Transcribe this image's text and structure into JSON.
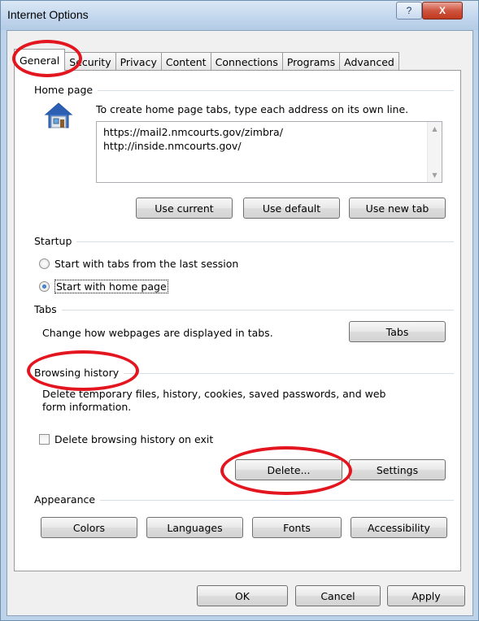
{
  "window": {
    "title": "Internet Options",
    "help_label": "?",
    "close_label": "X"
  },
  "tabs": [
    {
      "label": "General",
      "active": true
    },
    {
      "label": "Security"
    },
    {
      "label": "Privacy"
    },
    {
      "label": "Content"
    },
    {
      "label": "Connections"
    },
    {
      "label": "Programs"
    },
    {
      "label": "Advanced"
    }
  ],
  "home_page": {
    "heading": "Home page",
    "description": "To create home page tabs, type each address on its own line.",
    "urls_line1": "https://mail2.nmcourts.gov/zimbra/",
    "urls_line2": "http://inside.nmcourts.gov/",
    "use_current": "Use current",
    "use_default": "Use default",
    "use_new_tab": "Use new tab"
  },
  "startup": {
    "heading": "Startup",
    "option1": "Start with tabs from the last session",
    "option2": "Start with home page",
    "selected": "Start with home page"
  },
  "tabs_group": {
    "heading": "Tabs",
    "description": "Change how webpages are displayed in tabs.",
    "button": "Tabs"
  },
  "browsing_history": {
    "heading": "Browsing history",
    "description_line1": "Delete temporary files, history, cookies, saved passwords, and web",
    "description_line2": "form information.",
    "checkbox_label": "Delete browsing history on exit",
    "delete_button": "Delete...",
    "settings_button": "Settings"
  },
  "appearance": {
    "heading": "Appearance",
    "colors": "Colors",
    "languages": "Languages",
    "fonts": "Fonts",
    "accessibility": "Accessibility"
  },
  "footer": {
    "ok": "OK",
    "cancel": "Cancel",
    "apply": "Apply"
  },
  "annotation_color": "#e3151e"
}
